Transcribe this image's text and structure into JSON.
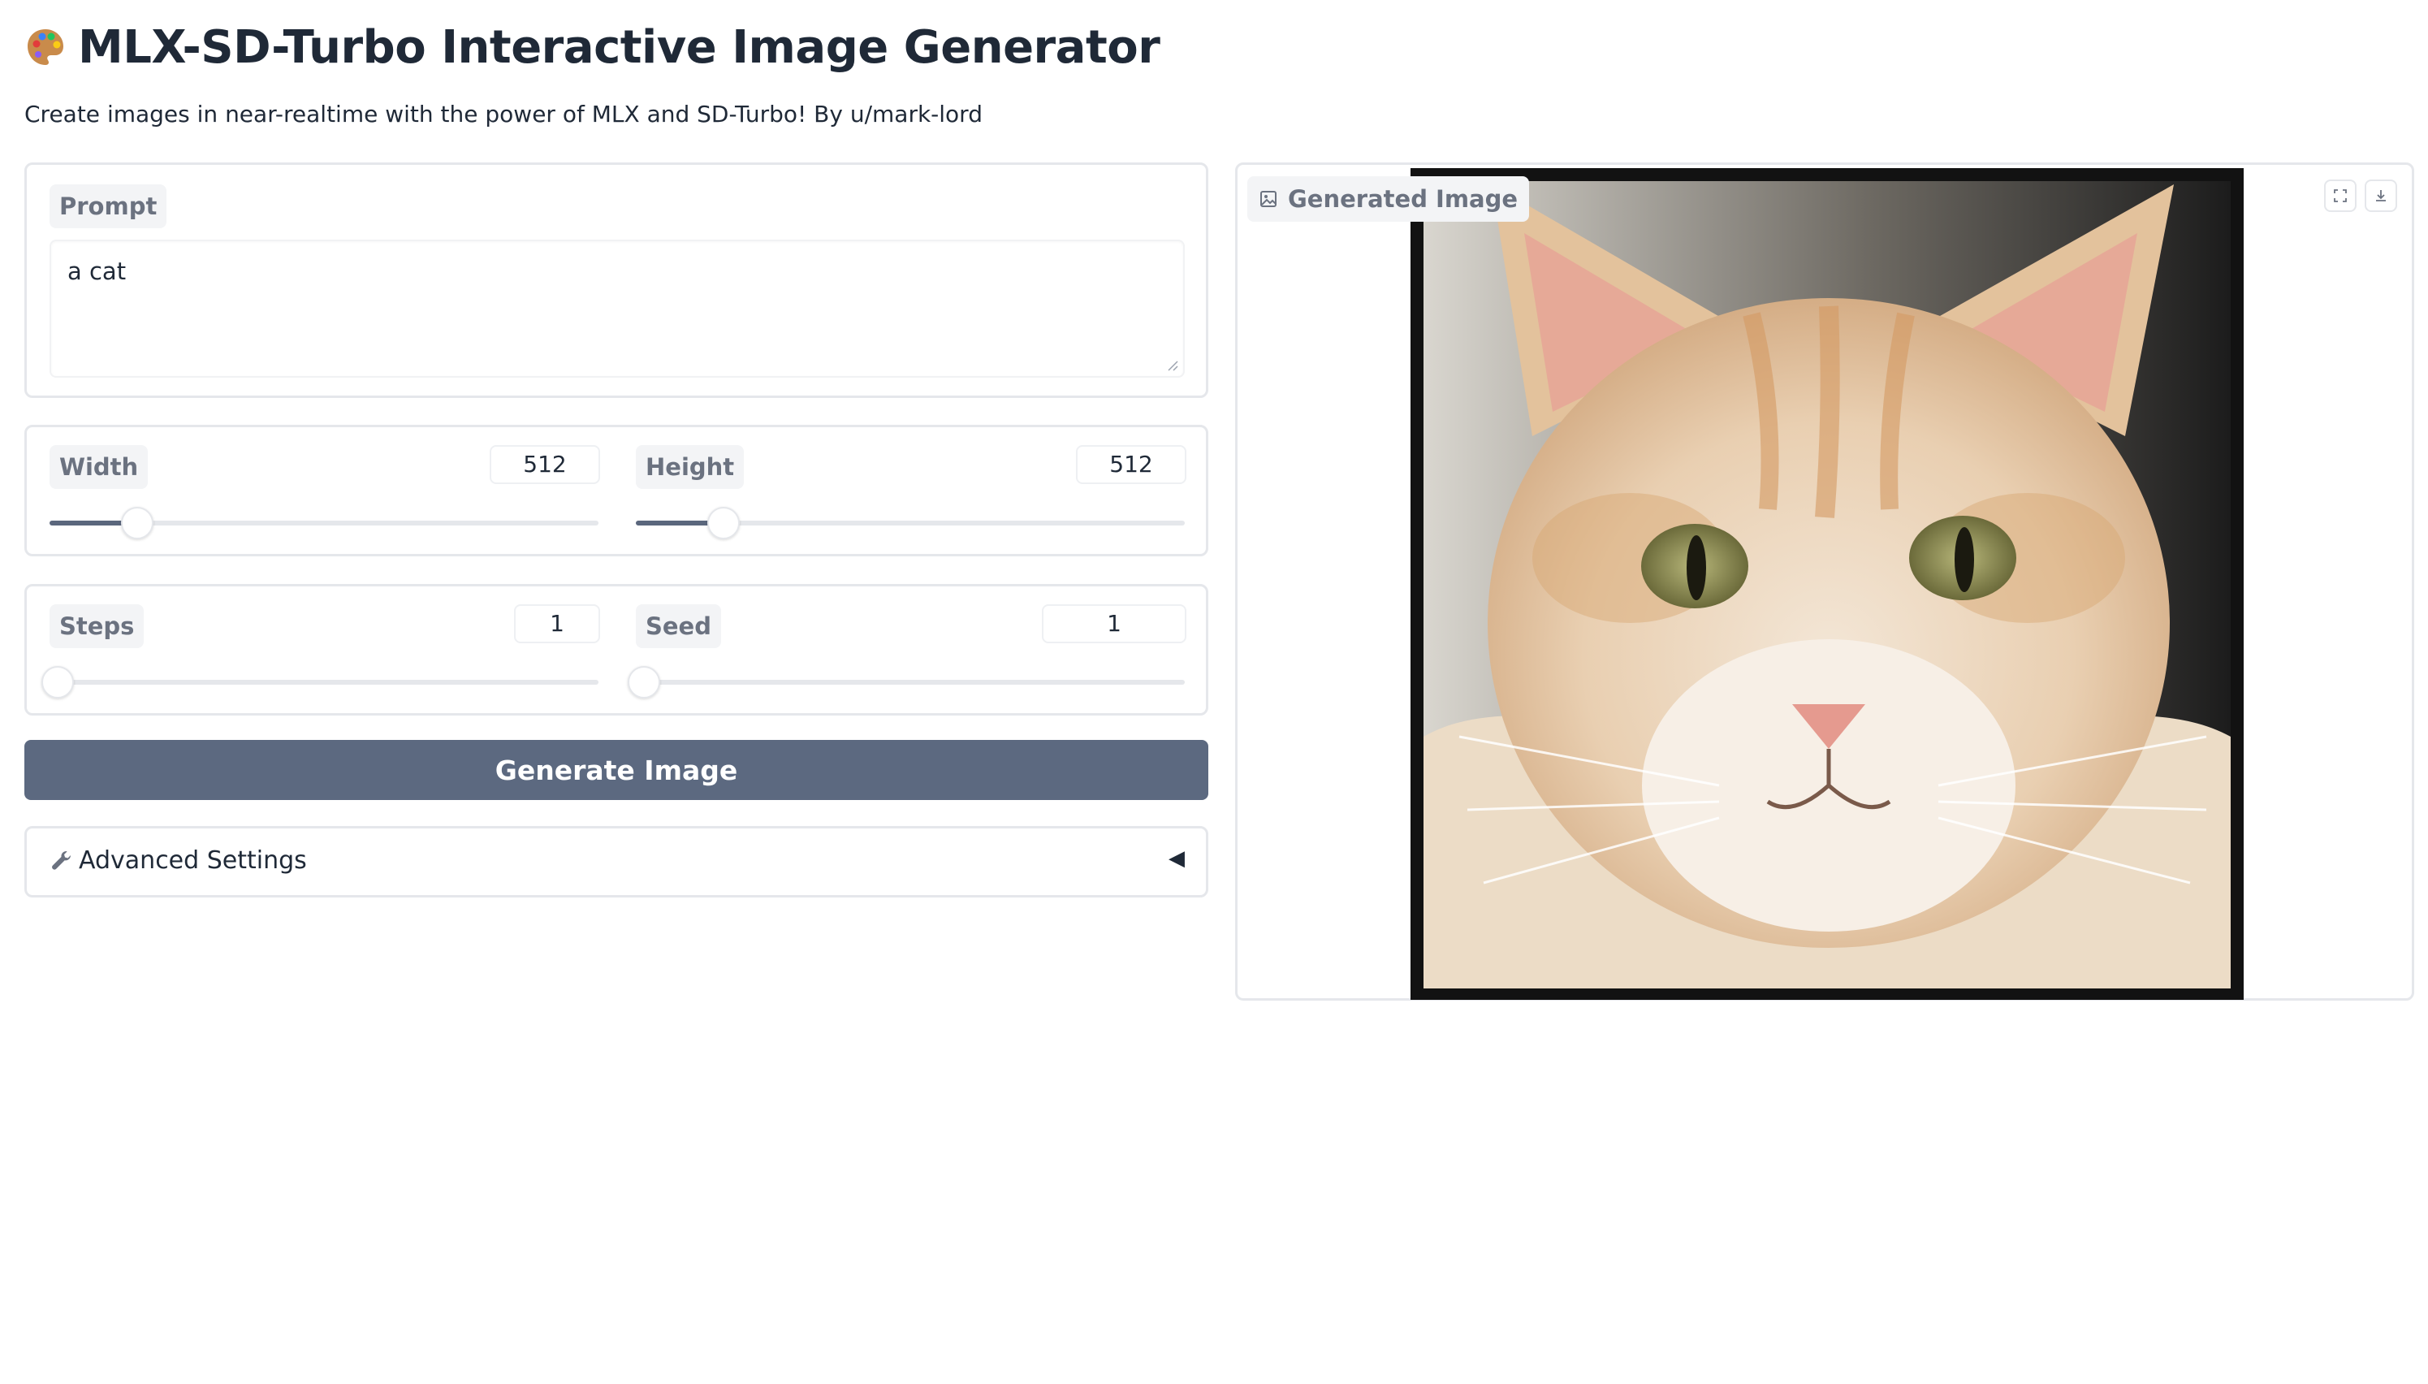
{
  "app": {
    "title": "MLX-SD-Turbo Interactive Image Generator",
    "subtitle": "Create images in near-realtime with the power of MLX and SD-Turbo! By u/mark-lord",
    "title_icon": "palette-icon"
  },
  "prompt": {
    "label": "Prompt",
    "value": "a cat"
  },
  "dimensions": {
    "width": {
      "label": "Width",
      "value": "512",
      "fraction": 0.16
    },
    "height": {
      "label": "Height",
      "value": "512",
      "fraction": 0.16
    }
  },
  "sampling": {
    "steps": {
      "label": "Steps",
      "value": "1",
      "fraction": 0.0
    },
    "seed": {
      "label": "Seed",
      "value": "1",
      "fraction": 0.0
    }
  },
  "actions": {
    "generate_label": "Generate Image"
  },
  "advanced": {
    "label": "Advanced Settings",
    "icon": "wrench-icon",
    "toggle_icon": "collapse-arrow-icon"
  },
  "output": {
    "label": "Generated Image",
    "label_icon": "image-icon",
    "buttons": [
      "fullscreen-icon",
      "download-icon"
    ]
  },
  "colors": {
    "primary_button": "#5c6980",
    "slider_fill": "#5b677d",
    "label_chip_bg": "#f3f4f6",
    "border": "#e5e7eb"
  }
}
